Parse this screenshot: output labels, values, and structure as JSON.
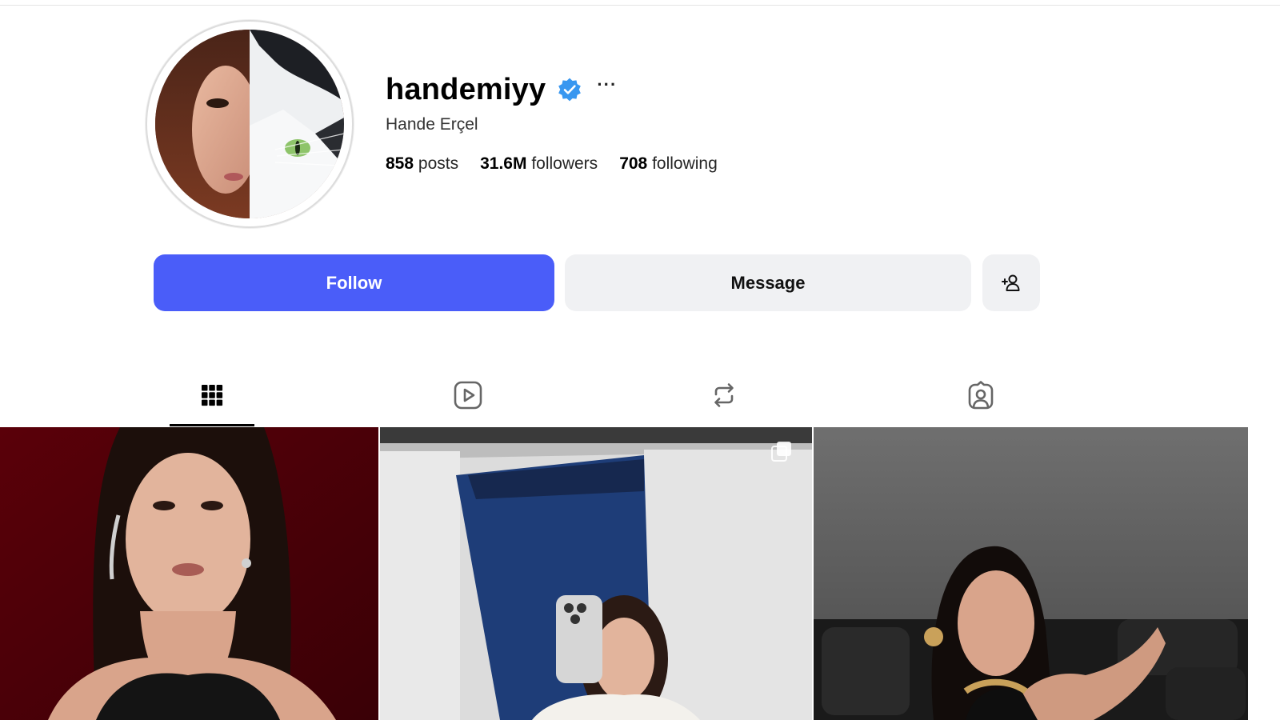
{
  "profile": {
    "username": "handemiyy",
    "verified": true,
    "more_label": "···",
    "full_name": "Hande Erçel",
    "stats": {
      "posts_count": "858",
      "posts_label": "posts",
      "followers_count": "31.6M",
      "followers_label": "followers",
      "following_count": "708",
      "following_label": "following"
    }
  },
  "actions": {
    "follow_label": "Follow",
    "message_label": "Message",
    "add_user_icon": "add-user-icon"
  },
  "tabs": [
    {
      "icon": "grid-icon",
      "active": true
    },
    {
      "icon": "reels-icon",
      "active": false
    },
    {
      "icon": "reposts-icon",
      "active": false
    },
    {
      "icon": "tagged-icon",
      "active": false
    }
  ],
  "posts": [
    {
      "multi_image": false
    },
    {
      "multi_image": true
    },
    {
      "multi_image": false
    }
  ],
  "colors": {
    "follow_button": "#4a5df9",
    "secondary_button": "#f0f1f3",
    "verified_badge": "#3897f0"
  }
}
